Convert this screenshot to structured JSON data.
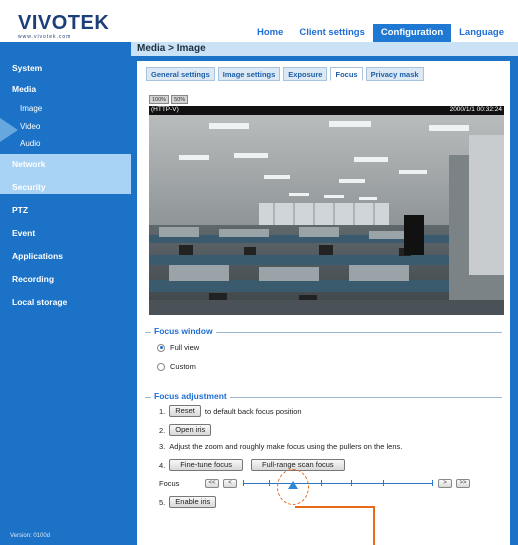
{
  "brand": {
    "logo": "VIVOTEK",
    "tagline": "www.vivotek.com"
  },
  "nav": {
    "tabs": [
      {
        "label": "Home"
      },
      {
        "label": "Client settings"
      },
      {
        "label": "Configuration",
        "active": true
      },
      {
        "label": "Language"
      }
    ]
  },
  "page_title": "Media > Image",
  "sidebar": {
    "items": [
      {
        "label": "System"
      },
      {
        "label": "Media"
      },
      {
        "label": "Image",
        "sub": true
      },
      {
        "label": "Video",
        "sub": true
      },
      {
        "label": "Audio",
        "sub": true
      },
      {
        "label": "Network"
      },
      {
        "label": "Security"
      },
      {
        "label": "PTZ"
      },
      {
        "label": "Event"
      },
      {
        "label": "Applications"
      },
      {
        "label": "Recording"
      },
      {
        "label": "Local storage"
      }
    ],
    "version": "Version: 0100d"
  },
  "subtabs": [
    {
      "label": "General settings"
    },
    {
      "label": "Image settings"
    },
    {
      "label": "Exposure"
    },
    {
      "label": "Focus",
      "active": true
    },
    {
      "label": "Privacy mask"
    }
  ],
  "viewer": {
    "btn1": "100%",
    "btn2": "50%",
    "stream": "(HTTP-V)",
    "timestamp": "2000/1/1 00:32:24"
  },
  "focus_window": {
    "legend": "Focus window",
    "options": [
      {
        "label": "Full view",
        "checked": true
      },
      {
        "label": "Custom",
        "checked": false
      }
    ]
  },
  "focus_adjustment": {
    "legend": "Focus adjustment",
    "step1_num": "1.",
    "reset_label": "Reset",
    "step1_text": "to default back focus position",
    "step2_num": "2.",
    "open_iris_label": "Open iris",
    "step3_num": "3.",
    "step3_text": "Adjust the zoom and roughly make focus using the pullers on the lens.",
    "step4_num": "4.",
    "fine_tune_label": "Fine-tune focus",
    "full_range_label": "Full-range scan focus",
    "focus_label": "Focus",
    "slider": {
      "rewind_fast": "<<",
      "rewind": "<",
      "forward": ">",
      "forward_fast": ">>",
      "position_fraction": 0.27
    },
    "step5_num": "5.",
    "enable_iris_label": "Enable iris"
  },
  "colors": {
    "accent": "#1b72c6",
    "highlight": "#a9d3f4",
    "callout": "#e86a1b"
  }
}
